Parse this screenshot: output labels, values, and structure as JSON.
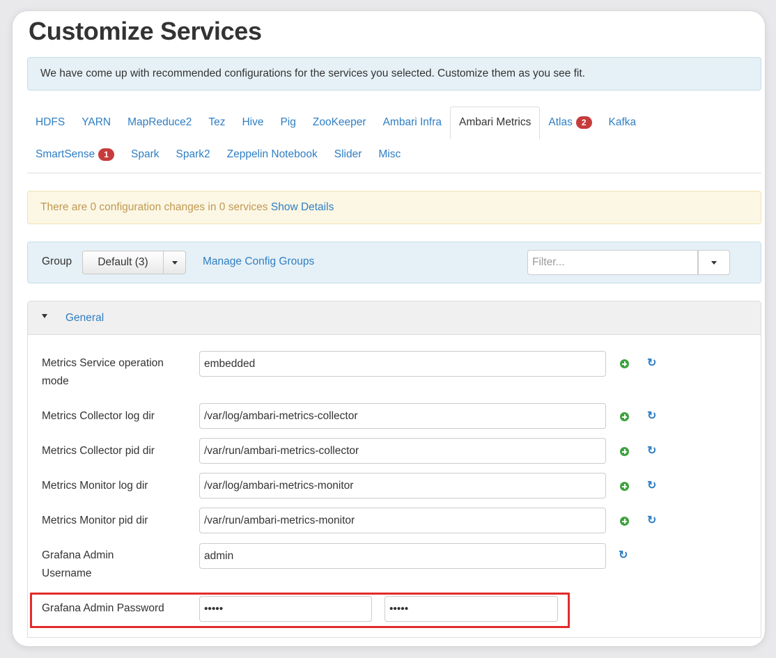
{
  "page": {
    "title": "Customize Services"
  },
  "info_banner": "We have come up with recommended configurations for the services you selected. Customize them as you see fit.",
  "tabs": [
    {
      "label": "HDFS"
    },
    {
      "label": "YARN"
    },
    {
      "label": "MapReduce2"
    },
    {
      "label": "Tez"
    },
    {
      "label": "Hive"
    },
    {
      "label": "Pig"
    },
    {
      "label": "ZooKeeper"
    },
    {
      "label": "Ambari Infra"
    },
    {
      "label": "Ambari Metrics",
      "active": true
    },
    {
      "label": "Atlas",
      "badge": "2"
    },
    {
      "label": "Kafka"
    },
    {
      "label": "SmartSense",
      "badge": "1"
    },
    {
      "label": "Spark"
    },
    {
      "label": "Spark2"
    },
    {
      "label": "Zeppelin Notebook"
    },
    {
      "label": "Slider"
    },
    {
      "label": "Misc"
    }
  ],
  "changes_banner": {
    "text": "There are 0 configuration changes in 0 services",
    "link": "Show Details"
  },
  "group_bar": {
    "label": "Group",
    "selected": "Default (3)",
    "manage_link": "Manage Config Groups",
    "filter_placeholder": "Filter..."
  },
  "section": {
    "title": "General",
    "properties": [
      {
        "label": "Metrics Service operation mode",
        "value": "embedded"
      },
      {
        "label": "Metrics Collector log dir",
        "value": "/var/log/ambari-metrics-collector"
      },
      {
        "label": "Metrics Collector pid dir",
        "value": "/var/run/ambari-metrics-collector"
      },
      {
        "label": "Metrics Monitor log dir",
        "value": "/var/log/ambari-metrics-monitor"
      },
      {
        "label": "Metrics Monitor pid dir",
        "value": "/var/run/ambari-metrics-monitor"
      },
      {
        "label": "Grafana Admin Username",
        "value": "admin"
      },
      {
        "label": "Grafana Admin Password",
        "value": "admin",
        "confirm_value": "admin"
      }
    ]
  },
  "icons": {
    "add": "plus-circle-icon",
    "undo": "refresh-icon",
    "dropdown": "caret-down-icon",
    "section_toggle": "caret-down-icon"
  },
  "colors": {
    "link": "#2f7ec3",
    "info_bg": "#e6f1f7",
    "warning_bg": "#fcf7e4",
    "warning_text": "#c09853",
    "badge": "#c73b3b",
    "add_icon": "#3fa23f",
    "highlight": "#e32b2b"
  }
}
